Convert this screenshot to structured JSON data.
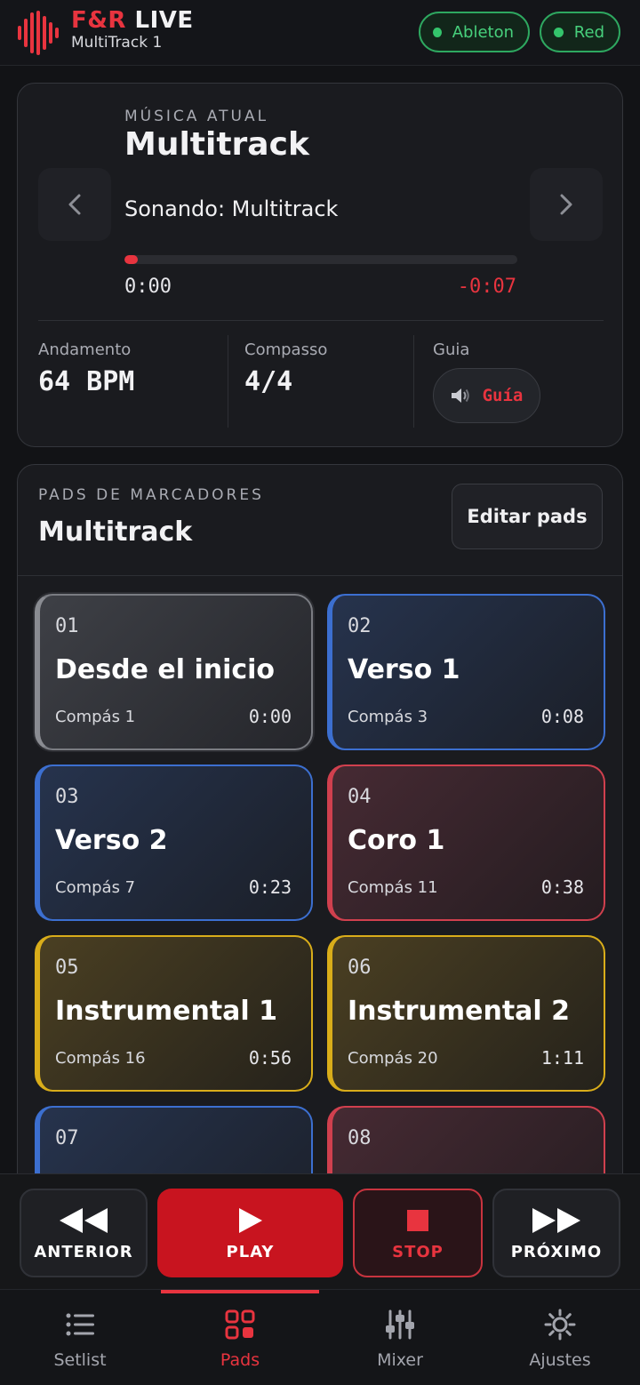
{
  "header": {
    "brand_part1": "F&R",
    "brand_part2": "LIVE",
    "subtitle": "MultiTrack 1",
    "status_ableton": "Ableton",
    "status_red": "Red",
    "status_color": "#34c46c"
  },
  "song": {
    "label": "MÚSICA ATUAL",
    "title": "Multitrack",
    "now_playing": "Sonando: Multitrack",
    "progress_fraction": 0.035,
    "elapsed": "0:00",
    "remaining": "-0:07",
    "prev_icon": "chevron-left-icon",
    "next_icon": "chevron-right-icon"
  },
  "stats": {
    "tempo_label": "Andamento",
    "tempo_value": "64 BPM",
    "meter_label": "Compasso",
    "meter_value": "4/4",
    "guide_label": "Guia",
    "guide_button": "Guía",
    "guide_icon": "speaker-icon"
  },
  "pads": {
    "label": "PADS DE MARCADORES",
    "title": "Multitrack",
    "edit_button": "Editar pads",
    "items": [
      {
        "num": "01",
        "name": "Desde el inicio",
        "bar": "Compás 1",
        "time": "0:00",
        "color": "gray"
      },
      {
        "num": "02",
        "name": "Verso 1",
        "bar": "Compás 3",
        "time": "0:08",
        "color": "blue"
      },
      {
        "num": "03",
        "name": "Verso 2",
        "bar": "Compás 7",
        "time": "0:23",
        "color": "blue"
      },
      {
        "num": "04",
        "name": "Coro 1",
        "bar": "Compás 11",
        "time": "0:38",
        "color": "red"
      },
      {
        "num": "05",
        "name": "Instrumental 1",
        "bar": "Compás 16",
        "time": "0:56",
        "color": "yellow"
      },
      {
        "num": "06",
        "name": "Instrumental 2",
        "bar": "Compás 20",
        "time": "1:11",
        "color": "yellow"
      },
      {
        "num": "07",
        "name": "",
        "bar": "",
        "time": "",
        "color": "blue"
      },
      {
        "num": "08",
        "name": "",
        "bar": "",
        "time": "",
        "color": "red"
      }
    ]
  },
  "transport": {
    "prev": "ANTERIOR",
    "play": "PLAY",
    "stop": "STOP",
    "next": "PRÓXIMO",
    "accent": "#c8141f"
  },
  "nav": {
    "items": [
      {
        "label": "Setlist",
        "icon": "list-icon"
      },
      {
        "label": "Pads",
        "icon": "grid-icon"
      },
      {
        "label": "Mixer",
        "icon": "sliders-icon"
      },
      {
        "label": "Ajustes",
        "icon": "gear-icon"
      }
    ],
    "active_index": 1
  }
}
